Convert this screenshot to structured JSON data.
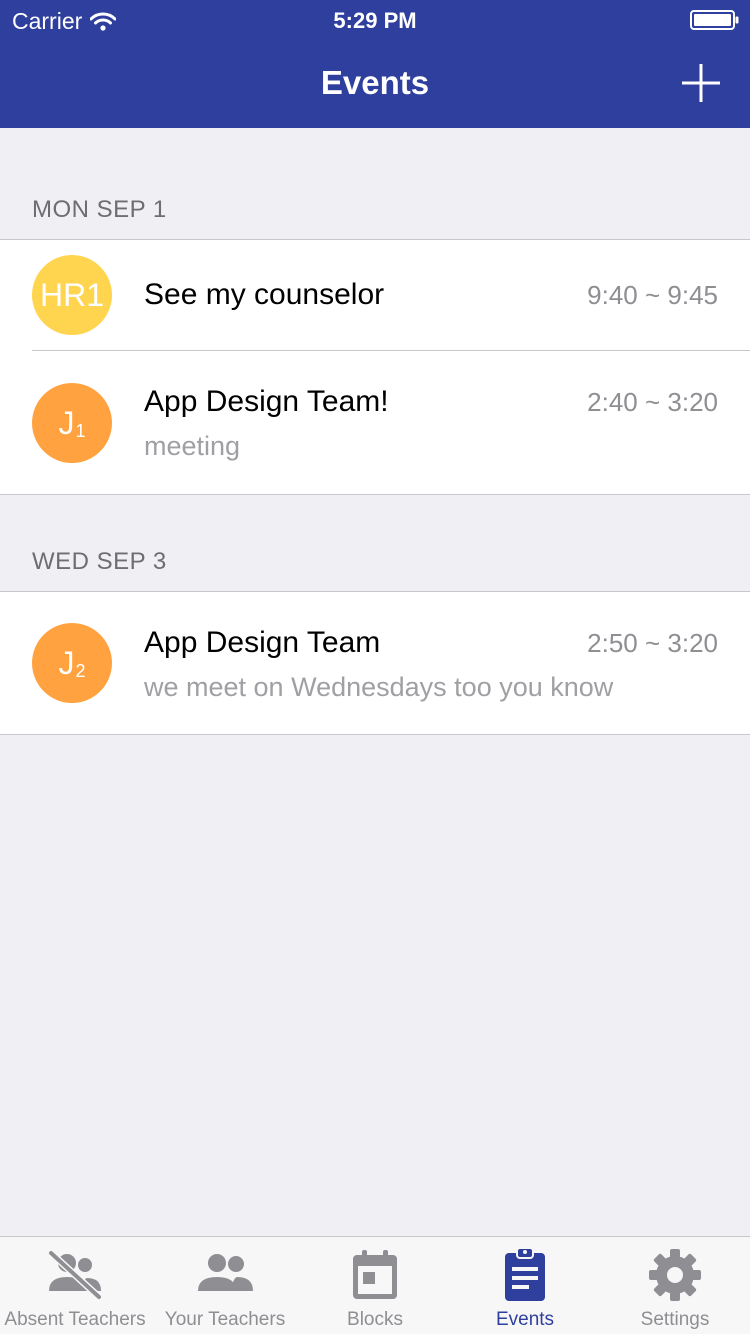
{
  "status_bar": {
    "carrier": "Carrier",
    "time": "5:29 PM"
  },
  "nav": {
    "title": "Events",
    "add_icon": "plus-icon"
  },
  "sections": [
    {
      "header": "MON SEP 1",
      "events": [
        {
          "avatar_main": "HR1",
          "avatar_sub": "",
          "avatar_color": "#ffd54f",
          "title": "See my counselor",
          "subtitle": "",
          "time": "9:40 ~ 9:45"
        },
        {
          "avatar_main": "J",
          "avatar_sub": "1",
          "avatar_color": "#ffa23f",
          "title": "App Design Team!",
          "subtitle": "meeting",
          "time": "2:40 ~ 3:20"
        }
      ]
    },
    {
      "header": "WED SEP 3",
      "events": [
        {
          "avatar_main": "J",
          "avatar_sub": "2",
          "avatar_color": "#ffa23f",
          "title": "App Design Team",
          "subtitle": "we meet on Wednesdays too you know",
          "time": "2:50 ~ 3:20"
        }
      ]
    }
  ],
  "tabs": [
    {
      "label": "Absent Teachers",
      "icon": "absent-teachers-icon",
      "active": false
    },
    {
      "label": "Your Teachers",
      "icon": "people-icon",
      "active": false
    },
    {
      "label": "Blocks",
      "icon": "calendar-icon",
      "active": false
    },
    {
      "label": "Events",
      "icon": "clipboard-icon",
      "active": true
    },
    {
      "label": "Settings",
      "icon": "gear-icon",
      "active": false
    }
  ],
  "colors": {
    "primary": "#2f3f9e",
    "inactive": "#8e8e93",
    "background": "#efeff4"
  }
}
